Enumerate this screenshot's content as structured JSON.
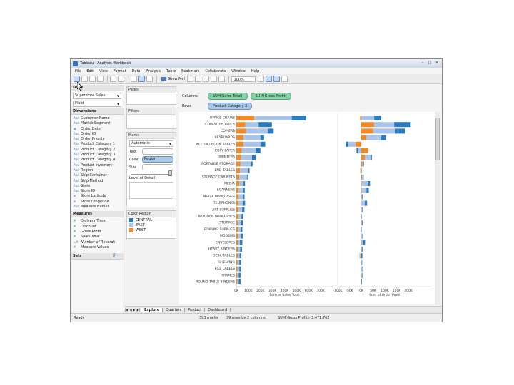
{
  "window": {
    "title": "Tableau - Analysis Workbook"
  },
  "menu": [
    "File",
    "Edit",
    "View",
    "Format",
    "Data",
    "Analysis",
    "Table",
    "Bookmark",
    "Collaborate",
    "Window",
    "Help"
  ],
  "toolbar": {
    "show_me": "Show Me!",
    "zoom": "100%"
  },
  "data_pane": {
    "header": "Data",
    "datasource": "Superstore Sales",
    "view_mode": "Fluid",
    "dimensions_header": "Dimensions",
    "dimensions": [
      {
        "icon": "Abc",
        "label": "Customer Name"
      },
      {
        "icon": "Abc",
        "label": "Market Segment"
      },
      {
        "icon": "cal",
        "label": "Order Date"
      },
      {
        "icon": "Abc",
        "label": "Order ID"
      },
      {
        "icon": "Abc",
        "label": "Order Priority"
      },
      {
        "icon": "Abc",
        "label": "Product Category 1"
      },
      {
        "icon": "Abc",
        "label": "Product Category 2"
      },
      {
        "icon": "Abc",
        "label": "Product Category 3"
      },
      {
        "icon": "Abc",
        "label": "Product Category 4"
      },
      {
        "icon": "Abc",
        "label": "Product Inventory"
      },
      {
        "icon": "Abc",
        "label": "Region"
      },
      {
        "icon": "Abc",
        "label": "Ship Container"
      },
      {
        "icon": "Abc",
        "label": "Ship Method"
      },
      {
        "icon": "Abc",
        "label": "State"
      },
      {
        "icon": "Abc",
        "label": "Store ID"
      },
      {
        "icon": "geo",
        "label": "Store Latitude"
      },
      {
        "icon": "geo",
        "label": "Store Longitude"
      },
      {
        "icon": "Abc",
        "label": "Measure Names"
      }
    ],
    "measures_header": "Measures",
    "measures": [
      "Delivery Time",
      "Discount",
      "Gross Profit",
      "Sales Total",
      "Number of Records",
      "Measure Values"
    ],
    "sets_header": "Sets"
  },
  "shelves": {
    "pages": "Pages",
    "filters": "Filters",
    "columns_label": "Columns",
    "rows_label": "Rows",
    "columns_pills": [
      "SUM(Sales Total)",
      "SUM(Gross Profit)"
    ],
    "rows_pills": [
      "Product Category 3"
    ]
  },
  "marks": {
    "header": "Marks",
    "type": "Automatic",
    "text_label": "Text",
    "color_label": "Color",
    "color_value": "Region",
    "size_label": "Size",
    "level_label": "Level of Detail"
  },
  "legend": {
    "header": "Color Region",
    "items": [
      {
        "label": "CENTRAL",
        "color": "#2a7ac0"
      },
      {
        "label": "EAST",
        "color": "#a9c4e6"
      },
      {
        "label": "WEST",
        "color": "#f0892a"
      }
    ]
  },
  "tabs": [
    "Explore",
    "Quarters",
    "Product",
    "Dashboard"
  ],
  "status": {
    "left": "Ready",
    "marks": "393 marks",
    "rows": "39 rows by 2 columns",
    "sum": "SUM(Gross Profit): 3,471,762"
  },
  "chart_data": {
    "type": "bar",
    "stacked": true,
    "categories": [
      "OFFICE CHAIRS",
      "COMPUTER PAPER",
      "COPIERS",
      "KEYBOARDS",
      "MEETING ROOM TABLES",
      "COPY PAPER",
      "PRINTERS",
      "PORTABLE STORAGE",
      "END TABLES",
      "STORAGE CABINETS",
      "MEDIA",
      "SCANNERS",
      "METAL BOOKCASES",
      "TELEPHONES",
      "ART SUPPLIES",
      "WOODEN BOOKCASES",
      "STORAGE",
      "BINDING SUPPLIES",
      "MODEMS",
      "ENVELOPES",
      "HEAVY BINDERS",
      "DESK TABLES",
      "SHELVING",
      "FILE LABELS",
      "FRAMES",
      "ROUND TABLE BINDERS"
    ],
    "series_order": [
      "WEST",
      "EAST",
      "CENTRAL"
    ],
    "colors": {
      "WEST": "#f0892a",
      "EAST": "#a9c4e6",
      "CENTRAL": "#2a7ac0"
    },
    "panels": [
      {
        "measure": "Sum of Sales Total",
        "xlim": [
          0,
          800000
        ],
        "ticks": [
          0,
          100000,
          200000,
          300000,
          400000,
          500000,
          600000,
          700000
        ],
        "tick_labels": [
          "0K",
          "100K",
          "200K",
          "300K",
          "400K",
          "500K",
          "600K",
          "700K"
        ],
        "series": [
          {
            "name": "WEST",
            "values": [
              150000,
              75000,
              80000,
              60000,
              60000,
              45000,
              40000,
              35000,
              30000,
              25000,
              25000,
              20000,
              18000,
              18000,
              18000,
              18000,
              12000,
              15000,
              15000,
              12000,
              12000,
              12000,
              10000,
              10000,
              8000,
              8000
            ]
          },
          {
            "name": "EAST",
            "values": [
              310000,
              110000,
              180000,
              140000,
              140000,
              115000,
              90000,
              85000,
              70000,
              65000,
              35000,
              35000,
              35000,
              35000,
              30000,
              25000,
              25000,
              20000,
              25000,
              18000,
              20000,
              15000,
              15000,
              15000,
              12000,
              12000
            ]
          },
          {
            "name": "CENTRAL",
            "values": [
              120000,
              110000,
              50000,
              30000,
              40000,
              40000,
              30000,
              15000,
              10000,
              10000,
              12000,
              15000,
              15000,
              20000,
              20000,
              15000,
              18000,
              15000,
              15000,
              20000,
              15000,
              15000,
              15000,
              15000,
              15000,
              15000
            ]
          }
        ]
      },
      {
        "measure": "Sum of Gross Profit",
        "xlim": [
          -100000,
          300000
        ],
        "ticks": [
          -100000,
          -50000,
          0,
          50000,
          100000,
          150000,
          200000
        ],
        "tick_labels": [
          "-100K",
          "-50K",
          "0K",
          "50K",
          "100K",
          "150K",
          "200K"
        ],
        "series": [
          {
            "name": "WEST",
            "values": [
              -5000,
              55000,
              50000,
              20000,
              -25000,
              30000,
              15000,
              5000,
              -3000,
              3000,
              2000,
              2000,
              1000,
              0,
              0,
              -1000,
              1000,
              0,
              0,
              1000,
              1000,
              -3000,
              0,
              0,
              1000,
              0
            ]
          },
          {
            "name": "EAST",
            "values": [
              55000,
              85000,
              95000,
              65000,
              -30000,
              -15000,
              25000,
              5000,
              -2000,
              5000,
              25000,
              20000,
              3000,
              15000,
              3000,
              -2000,
              3000,
              -3000,
              5000,
              5000,
              3000,
              -5000,
              2000,
              5000,
              2000,
              1000
            ]
          },
          {
            "name": "CENTRAL",
            "values": [
              30000,
              70000,
              40000,
              20000,
              -10000,
              -5000,
              5000,
              2000,
              1000,
              2000,
              10000,
              10000,
              2000,
              10000,
              2000,
              1000,
              2000,
              1000,
              2000,
              10000,
              3000,
              5000,
              2000,
              3000,
              2000,
              2000
            ]
          }
        ]
      }
    ],
    "bar_labels_visible": true
  }
}
